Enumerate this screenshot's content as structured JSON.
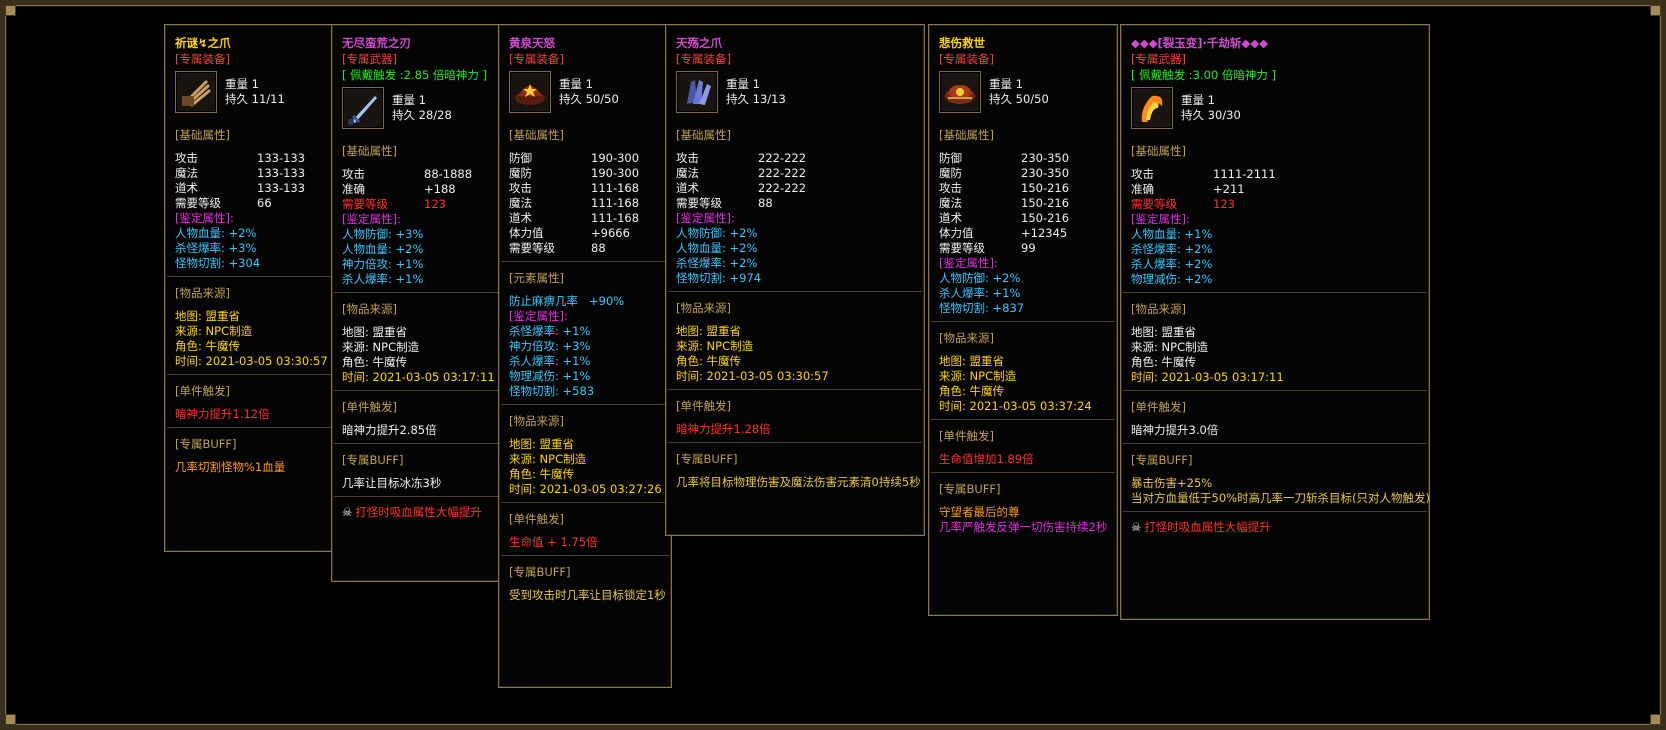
{
  "cards": [
    {
      "name": "祈谜↯之爪",
      "tag": "[专属装备]",
      "weight_label": "重量",
      "weight": "1",
      "dura_label": "持久",
      "dura": "11/11",
      "basic_title": "[基础属性]",
      "basic": [
        {
          "k": "攻击",
          "v": "133-133"
        },
        {
          "k": "魔法",
          "v": "133-133"
        },
        {
          "k": "道术",
          "v": "133-133"
        },
        {
          "k": "需要等级",
          "v": "66"
        }
      ],
      "appraise_title": "[鉴定属性]:",
      "appraise": [
        "人物血量: +2%",
        "杀怪爆率: +3%",
        "怪物切割: +304"
      ],
      "source_title": "[物品来源]",
      "source": [
        "地图: 盟重省",
        "来源: NPC制造",
        "角色: 牛魔传",
        "时间: 2021-03-05 03:30:57"
      ],
      "trigger_title": "[单件触发]",
      "trigger": "暗神力提升1.12倍",
      "buff_title": "[专属BUFF]",
      "buff": [
        "几率切割怪物%1血量"
      ]
    },
    {
      "name": "无尽蛮荒之刃",
      "tag": "[专属武器]",
      "trigger_bonus": "[ 佩戴触发 :2.85 倍暗神力 ]",
      "weight_label": "重量",
      "weight": "1",
      "dura_label": "持久",
      "dura": "28/28",
      "basic_title": "[基础属性]",
      "basic": [
        {
          "k": "攻击",
          "v": "88-1888"
        },
        {
          "k": "准确",
          "v": "+188"
        },
        {
          "k": "需要等级",
          "v": "123"
        }
      ],
      "appraise_title": "[鉴定属性]:",
      "appraise": [
        "人物防御: +3%",
        "人物血量: +2%",
        "神力倍攻: +1%",
        "杀人爆率: +1%"
      ],
      "source_title": "[物品来源]",
      "source": [
        "地图: 盟重省",
        "来源: NPC制造",
        "角色: 牛魔传",
        "时间: 2021-03-05 03:17:11"
      ],
      "trigger_title": "[单件触发]",
      "trigger": "暗神力提升2.85倍",
      "buff_title": "[专属BUFF]",
      "buff": [
        "几率让目标冰冻3秒"
      ],
      "extra": "打怪时吸血属性大幅提升"
    },
    {
      "name": "黄泉天怒",
      "tag": "[专属装备]",
      "weight_label": "重量",
      "weight": "1",
      "dura_label": "持久",
      "dura": "50/50",
      "basic_title": "[基础属性]",
      "basic": [
        {
          "k": "防御",
          "v": "190-300"
        },
        {
          "k": "魔防",
          "v": "190-300"
        },
        {
          "k": "攻击",
          "v": "111-168"
        },
        {
          "k": "魔法",
          "v": "111-168"
        },
        {
          "k": "道术",
          "v": "111-168"
        },
        {
          "k": "体力值",
          "v": "+9666"
        },
        {
          "k": "需要等级",
          "v": "88"
        }
      ],
      "element_title": "[元素属性]",
      "element": {
        "k": "防止麻痹几率",
        "v": "+90%"
      },
      "appraise_title": "[鉴定属性]:",
      "appraise": [
        "杀怪爆率: +1%",
        "神力倍攻: +3%",
        "杀人爆率: +1%",
        "物理减伤: +1%",
        "怪物切割: +583"
      ],
      "source_title": "[物品来源]",
      "source": [
        "地图: 盟重省",
        "来源: NPC制造",
        "角色: 牛魔传",
        "时间: 2021-03-05 03:27:26"
      ],
      "trigger_title": "[单件触发]",
      "trigger": "生命值 + 1.75倍",
      "buff_title": "[专属BUFF]",
      "buff": [
        "受到攻击时几率让目标锁定1秒"
      ]
    },
    {
      "name": "天殇之爪",
      "tag": "[专属装备]",
      "weight_label": "重量",
      "weight": "1",
      "dura_label": "持久",
      "dura": "13/13",
      "basic_title": "[基础属性]",
      "basic": [
        {
          "k": "攻击",
          "v": "222-222"
        },
        {
          "k": "魔法",
          "v": "222-222"
        },
        {
          "k": "道术",
          "v": "222-222"
        },
        {
          "k": "需要等级",
          "v": "88"
        }
      ],
      "appraise_title": "[鉴定属性]:",
      "appraise": [
        "人物防御: +2%",
        "人物血量: +2%",
        "杀怪爆率: +2%",
        "怪物切割: +974"
      ],
      "source_title": "[物品来源]",
      "source": [
        "地图: 盟重省",
        "来源: NPC制造",
        "角色: 牛魔传",
        "时间: 2021-03-05 03:30:57"
      ],
      "trigger_title": "[单件触发]",
      "trigger": "暗神力提升1.28倍",
      "buff_title": "[专属BUFF]",
      "buff": [
        "几率将目标物理伤害及魔法伤害元素清0持续5秒"
      ]
    },
    {
      "name": "悲伤救世",
      "tag": "[专属装备]",
      "weight_label": "重量",
      "weight": "1",
      "dura_label": "持久",
      "dura": "50/50",
      "basic_title": "[基础属性]",
      "basic": [
        {
          "k": "防御",
          "v": "230-350"
        },
        {
          "k": "魔防",
          "v": "230-350"
        },
        {
          "k": "攻击",
          "v": "150-216"
        },
        {
          "k": "魔法",
          "v": "150-216"
        },
        {
          "k": "道术",
          "v": "150-216"
        },
        {
          "k": "体力值",
          "v": "+12345"
        },
        {
          "k": "需要等级",
          "v": "99"
        }
      ],
      "appraise_title": "[鉴定属性]:",
      "appraise": [
        "人物防御: +2%",
        "杀人爆率: +1%",
        "怪物切割: +837"
      ],
      "source_title": "[物品来源]",
      "source": [
        "地图: 盟重省",
        "来源: NPC制造",
        "角色: 牛魔传",
        "时间: 2021-03-05 03:37:24"
      ],
      "trigger_title": "[单件触发]",
      "trigger": "生命值增加1.89倍",
      "buff_title": "[专属BUFF]",
      "buff": [
        "守望者最后的尊",
        "几率严触发反弹一切伤害持续2秒"
      ]
    },
    {
      "name": "◆◆◆[裂玉变]·千劫斩◆◆◆",
      "tag": "[专属武器]",
      "trigger_bonus": "[ 佩戴触发 :3.00 倍暗神力 ]",
      "weight_label": "重量",
      "weight": "1",
      "dura_label": "持久",
      "dura": "30/30",
      "basic_title": "[基础属性]",
      "basic": [
        {
          "k": "攻击",
          "v": "1111-2111"
        },
        {
          "k": "准确",
          "v": "+211"
        },
        {
          "k": "需要等级",
          "v": "123"
        }
      ],
      "appraise_title": "[鉴定属性]:",
      "appraise": [
        "人物血量: +1%",
        "杀怪爆率: +2%",
        "杀人爆率: +2%",
        "物理减伤: +2%"
      ],
      "source_title": "[物品来源]",
      "source": [
        "地图: 盟重省",
        "来源: NPC制造",
        "角色: 牛魔传",
        "时间: 2021-03-05 03:17:11"
      ],
      "trigger_title": "[单件触发]",
      "trigger": "暗神力提升3.0倍",
      "buff_title": "[专属BUFF]",
      "buff": [
        "暴击伤害+25%",
        "当对方血量低于50%时高几率一刀斩杀目标(只对人物触发)"
      ],
      "extra": "打怪时吸血属性大幅提升"
    }
  ],
  "icons": [
    "claw-icon",
    "sword-icon",
    "helmet-icon",
    "gauntlet-icon",
    "hat-icon",
    "fire-blade-icon"
  ],
  "colors": {
    "frame": "#8a7448",
    "red": "#ff3030",
    "gold": "#ffd400",
    "cyan": "#38c8ff",
    "green": "#22ee22",
    "magenta": "#e030e0"
  }
}
